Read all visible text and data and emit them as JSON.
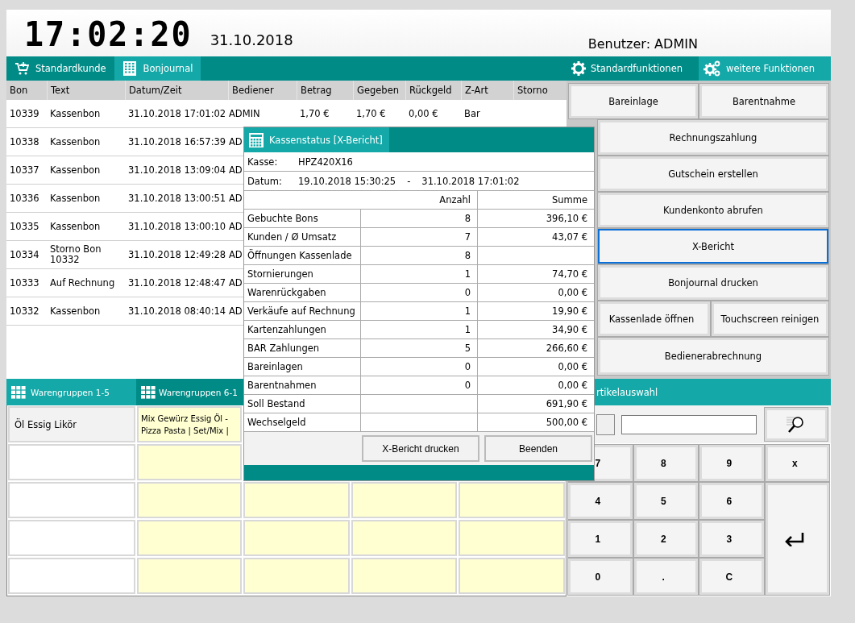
{
  "header": {
    "time": "17:02:20",
    "date": "31.10.2018",
    "user": "Benutzer: ADMIN"
  },
  "main_tabs": [
    {
      "label": "Standardkunde",
      "kind": "cart",
      "selected": false
    },
    {
      "label": "Bonjournal",
      "kind": "building",
      "selected": true
    }
  ],
  "journal": {
    "columns": [
      "Bon",
      "Text",
      "Datum/Zeit",
      "Bediener",
      "Betrag",
      "Gegeben",
      "Rückgeld",
      "Z-Art",
      "Storno"
    ],
    "rows": [
      {
        "bon": "10339",
        "text": "Kassenbon",
        "datum": "31.10.2018 17:01:02",
        "bediener": "ADMIN",
        "betrag": "1,70 €",
        "gegeben": "1,70 €",
        "rueckgeld": "0,00 €",
        "zart": "Bar"
      },
      {
        "bon": "10338",
        "text": "Kassenbon",
        "datum": "31.10.2018 16:57:39",
        "bediener": "AD"
      },
      {
        "bon": "10337",
        "text": "Kassenbon",
        "datum": "31.10.2018 13:09:04",
        "bediener": "AD"
      },
      {
        "bon": "10336",
        "text": "Kassenbon",
        "datum": "31.10.2018 13:00:51",
        "bediener": "AD"
      },
      {
        "bon": "10335",
        "text": "Kassenbon",
        "datum": "31.10.2018 13:00:10",
        "bediener": "AD"
      },
      {
        "bon": "10334",
        "text": "Storno Bon 10332",
        "datum": "31.10.2018 12:49:28",
        "bediener": "AD"
      },
      {
        "bon": "10333",
        "text": "Auf Rechnung",
        "datum": "31.10.2018 12:48:47",
        "bediener": "AD"
      },
      {
        "bon": "10332",
        "text": "Kassenbon",
        "datum": "31.10.2018 08:40:14",
        "bediener": "AD"
      }
    ]
  },
  "product_tabs": [
    {
      "label": "Warengruppen 1-5",
      "selected": true
    },
    {
      "label": "Warengruppen 6-1",
      "selected": false
    }
  ],
  "product_groups": [
    "Öl Essig Likör"
  ],
  "subgroups": [
    "Mix Gewürz Essig Öl - Pizza  Pasta | Set/Mix |"
  ],
  "function_tabs": [
    {
      "label": "Standardfunktionen",
      "kind": "gear",
      "selected": false
    },
    {
      "label": "weitere Funktionen",
      "kind": "gears",
      "selected": true
    }
  ],
  "function_buttons": [
    [
      {
        "label": "Bareinlage",
        "focused": false
      },
      {
        "label": "Barentnahme",
        "focused": false
      }
    ],
    [
      {
        "label": "Rechnungszahlung",
        "focused": false
      }
    ],
    [
      {
        "label": "Gutschein erstellen",
        "focused": false
      }
    ],
    [
      {
        "label": "Kundenkonto abrufen",
        "focused": false
      }
    ],
    [
      {
        "label": "X-Bericht",
        "focused": true
      }
    ],
    [
      {
        "label": "Bonjournal drucken",
        "focused": false
      }
    ],
    [
      {
        "label": "Kassenlade öffnen",
        "focused": false
      },
      {
        "label": "Touchscreen reinigen",
        "focused": false
      }
    ],
    [
      {
        "label": "Bedienerabrechnung",
        "focused": false
      }
    ]
  ],
  "article_bar": {
    "title": "rtikelauswahl"
  },
  "keypad": [
    {
      "kind": "key",
      "label": "7"
    },
    {
      "kind": "key",
      "label": "8"
    },
    {
      "kind": "key",
      "label": "9"
    },
    {
      "kind": "key",
      "label": "x"
    },
    {
      "kind": "key",
      "label": "4"
    },
    {
      "kind": "key",
      "label": "5"
    },
    {
      "kind": "key",
      "label": "6"
    },
    {
      "kind": "enter"
    },
    {
      "kind": "key",
      "label": "1"
    },
    {
      "kind": "key",
      "label": "2"
    },
    {
      "kind": "key",
      "label": "3"
    },
    {
      "kind": "key",
      "label": "0"
    },
    {
      "kind": "key",
      "label": "."
    },
    {
      "kind": "key",
      "label": "C"
    }
  ],
  "dialog": {
    "title": "Kassenstatus [X-Bericht]",
    "kasse_label": "Kasse:",
    "kasse": "HPZ420X16",
    "datum_label": "Datum:",
    "datum_from": "19.10.2018 15:30:25",
    "datum_sep": "-",
    "datum_to": "31.10.2018 17:01:02",
    "columns": [
      "Anzahl",
      "Summe"
    ],
    "rows": [
      {
        "label": "Gebuchte Bons",
        "count": "8",
        "sum": "396,10 €"
      },
      {
        "label": "Kunden / Ø Umsatz",
        "count": "7",
        "sum": "43,07 €"
      },
      {
        "label": "Öffnungen Kassenlade",
        "count": "8"
      },
      {
        "label": "Stornierungen",
        "count": "1",
        "sum": "74,70 €"
      },
      {
        "label": "Warenrückgaben",
        "count": "0",
        "sum": "0,00 €"
      },
      {
        "label": "Verkäufe auf Rechnung",
        "count": "1",
        "sum": "19,90 €"
      },
      {
        "label": "Kartenzahlungen",
        "count": "1",
        "sum": "34,90 €"
      },
      {
        "label": "BAR Zahlungen",
        "count": "5",
        "sum": "266,60 €"
      },
      {
        "label": "Bareinlagen",
        "count": "0",
        "sum": "0,00 €"
      },
      {
        "label": "Barentnahmen",
        "count": "0",
        "sum": "0,00 €"
      },
      {
        "label": "Soll Bestand",
        "sum": "691,90 €"
      },
      {
        "label": "Wechselgeld",
        "sum": "500,00 €"
      }
    ],
    "buttons": [
      "X-Bericht drucken",
      "Beenden"
    ]
  }
}
